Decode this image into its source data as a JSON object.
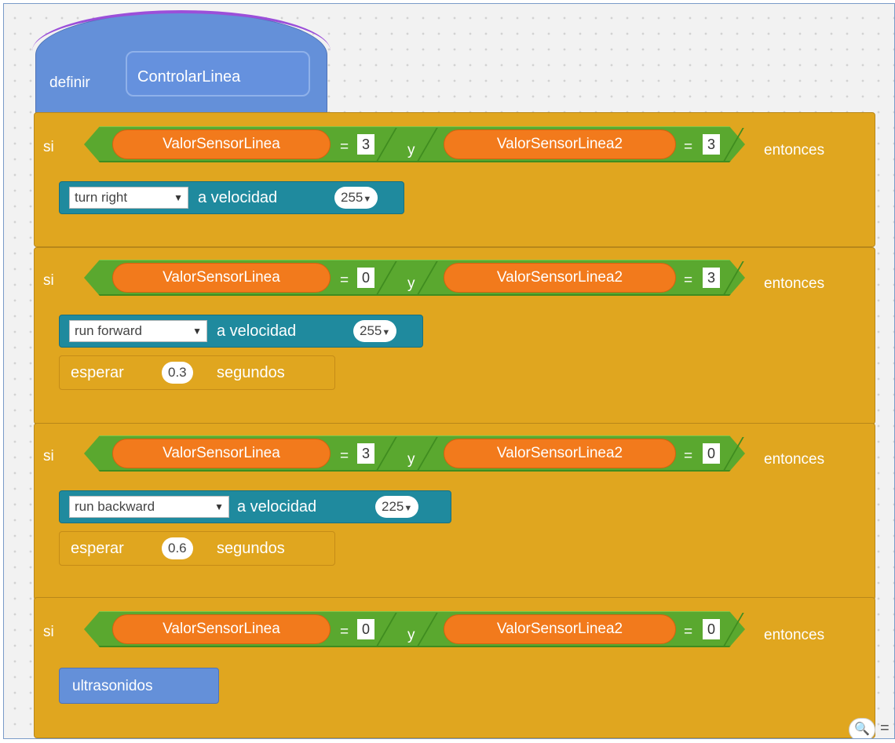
{
  "define_block": {
    "keyword": "definir",
    "name": "ControlarLinea"
  },
  "if_keyword": "si",
  "then_keyword": "entonces",
  "and_keyword": "y",
  "equals": "=",
  "blocks": [
    {
      "left_var": "ValorSensorLinea",
      "left_val": "3",
      "right_var": "ValorSensorLinea2",
      "right_val": "3",
      "motor": {
        "action": "turn right",
        "speed_label": "a velocidad",
        "speed": "255"
      }
    },
    {
      "left_var": "ValorSensorLinea",
      "left_val": "0",
      "right_var": "ValorSensorLinea2",
      "right_val": "3",
      "motor": {
        "action": "run forward",
        "speed_label": "a velocidad",
        "speed": "255"
      },
      "wait": {
        "label": "esperar",
        "value": "0.3",
        "unit": "segundos"
      }
    },
    {
      "left_var": "ValorSensorLinea",
      "left_val": "3",
      "right_var": "ValorSensorLinea2",
      "right_val": "0",
      "motor": {
        "action": "run backward",
        "speed_label": "a velocidad",
        "speed": "225"
      },
      "wait": {
        "label": "esperar",
        "value": "0.6",
        "unit": "segundos"
      }
    },
    {
      "left_var": "ValorSensorLinea",
      "left_val": "0",
      "right_var": "ValorSensorLinea2",
      "right_val": "0",
      "call": "ultrasonidos"
    }
  ],
  "zoom": {
    "icon": "zoom-out-icon",
    "glyph": "🔍",
    "extra": "="
  },
  "colors": {
    "control": "#e0a61f",
    "operator": "#5aa82f",
    "variable": "#f27a1c",
    "motor": "#1f8a9e",
    "custom": "#6490d9"
  }
}
